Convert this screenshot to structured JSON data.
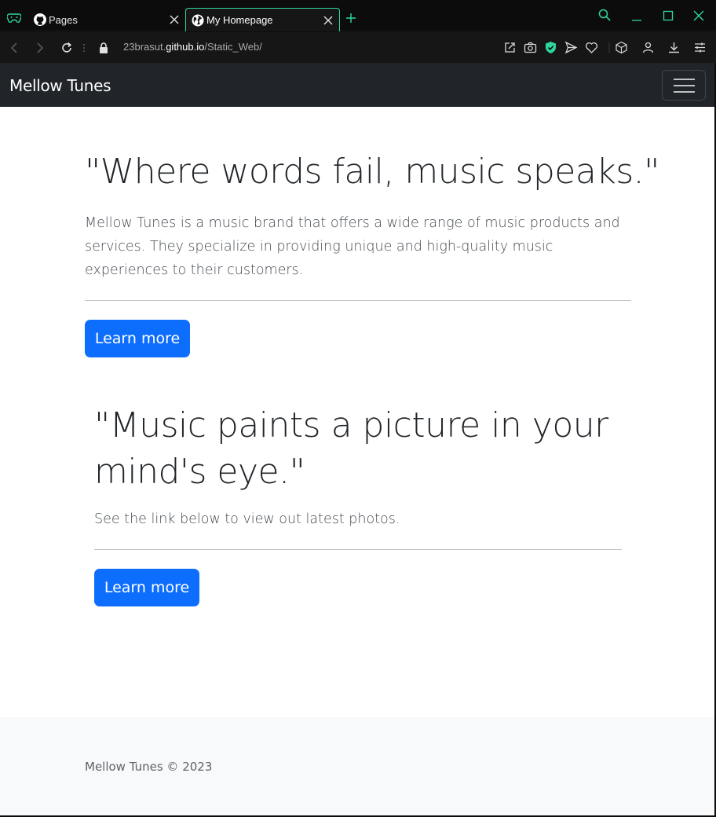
{
  "browser": {
    "tabs": [
      {
        "title": "Pages",
        "favicon": "github-icon"
      },
      {
        "title": "My Homepage",
        "favicon": "globe-icon",
        "active": true
      }
    ],
    "address": {
      "prefix": "23brasut.",
      "host": "github.io",
      "path": "/Static_Web/"
    },
    "accent_color": "#2fd7a0"
  },
  "navbar": {
    "brand": "Mellow Tunes",
    "toggler_icon": "hamburger-icon"
  },
  "sections": [
    {
      "quote": "\"Where words fail, music speaks.\"",
      "lead": "Mellow Tunes is a music brand that offers a wide range of music products and services. They specialize in providing unique and high-quality music experiences to their customers.",
      "button": "Learn more"
    },
    {
      "quote": "\"Music paints a picture in your mind's eye.\"",
      "lead": "See the link below to view out latest photos.",
      "button": "Learn more"
    }
  ],
  "footer": {
    "text": "Mellow Tunes © 2023"
  },
  "colors": {
    "primary": "#0d6efd",
    "navbar": "#212529",
    "footer_bg": "#f8f9fa"
  }
}
